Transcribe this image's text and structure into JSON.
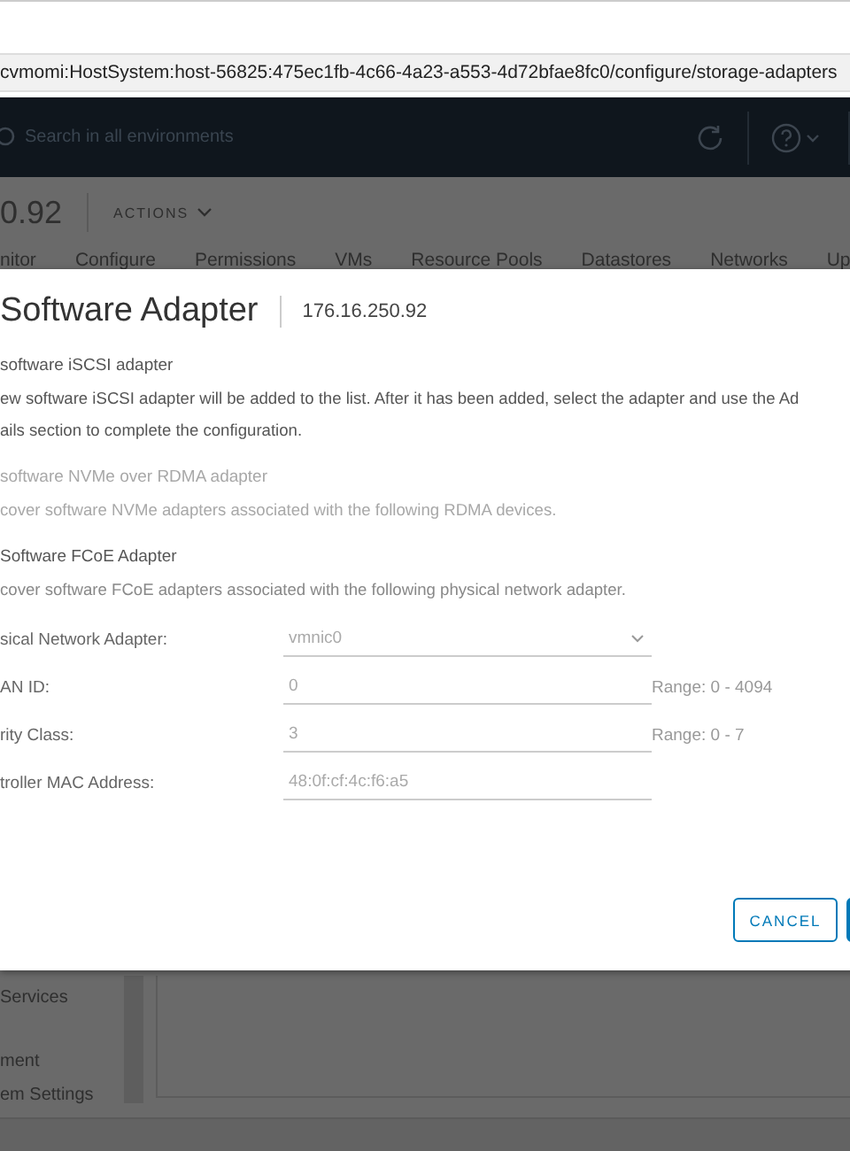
{
  "browser": {
    "address": "cvmomi:HostSystem:host-56825:475ec1fb-4c66-4a23-a553-4d72bfae8fc0/configure/storage-adapters"
  },
  "header": {
    "search_placeholder": "Search in all environments"
  },
  "host": {
    "title": "0.92",
    "actions": "ACTIONS"
  },
  "tabs": [
    "nitor",
    "Configure",
    "Permissions",
    "VMs",
    "Resource Pools",
    "Datastores",
    "Networks",
    "Up"
  ],
  "dialog": {
    "title": "Software Adapter",
    "subtitle": "176.16.250.92",
    "options": [
      {
        "label": "software iSCSI adapter",
        "description": [
          "ew software iSCSI adapter will be added to the list. After it has been added, select the adapter and use the Ad",
          "ails section to complete the configuration."
        ],
        "disabled": false
      },
      {
        "label": "software NVMe over RDMA adapter",
        "description": [
          "cover software NVMe adapters associated with the following RDMA devices."
        ],
        "disabled": true
      },
      {
        "label": "Software FCoE Adapter",
        "description": [
          "cover software FCoE adapters associated with the following physical network adapter."
        ],
        "disabled": false
      }
    ],
    "fields": [
      {
        "kind": "select",
        "label": "sical Network Adapter:",
        "value": "vmnic0"
      },
      {
        "kind": "input",
        "label": "AN ID:",
        "value": "0",
        "range": "Range: 0 - 4094"
      },
      {
        "kind": "input",
        "label": "rity Class:",
        "value": "3",
        "range": "Range: 0 - 7"
      },
      {
        "kind": "input",
        "label": "troller MAC Address:",
        "value": "48:0f:cf:4c:f6:a5"
      }
    ],
    "buttons": [
      {
        "kind": "secondary",
        "label": "CANCEL"
      },
      {
        "kind": "primary"
      }
    ]
  },
  "sidebar": {
    "items": [
      "Services",
      "ment",
      "em Settings"
    ]
  }
}
